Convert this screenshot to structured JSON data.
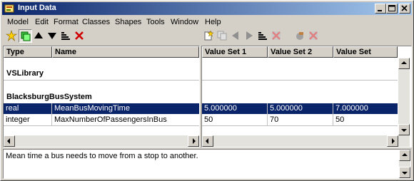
{
  "window": {
    "title": "Input Data"
  },
  "menubar": {
    "items": [
      "Model",
      "Edit",
      "Format",
      "Classes",
      "Shapes",
      "Tools",
      "Window",
      "Help"
    ]
  },
  "left_table": {
    "headers": [
      "Type",
      "Name"
    ],
    "groups": [
      "VSLibrary",
      "BlacksburgBusSystem"
    ],
    "rows": [
      {
        "type": "real",
        "name": "MeanBusMovingTime",
        "selected": true
      },
      {
        "type": "integer",
        "name": "MaxNumberOfPassengersInBus",
        "selected": false
      }
    ]
  },
  "right_table": {
    "headers": [
      "Value Set 1",
      "Value Set 2",
      "Value Set"
    ],
    "rows": [
      [
        "5.000000",
        "5.000000",
        "7.000000"
      ],
      [
        "50",
        "70",
        "50"
      ]
    ]
  },
  "description": {
    "text": "Mean time a bus needs to move from a stop to another."
  },
  "colors": {
    "selection": "#0a246a",
    "title_start": "#0a246a",
    "title_end": "#a6caf0"
  }
}
